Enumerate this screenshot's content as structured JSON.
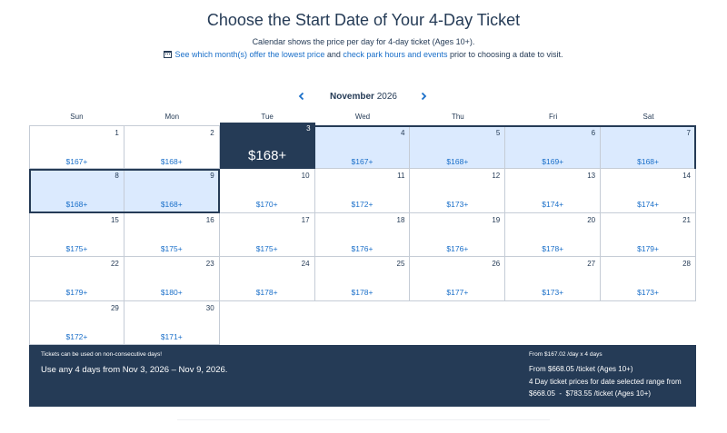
{
  "header": {
    "title": "Choose the Start Date of Your 4-Day Ticket",
    "subtitle": "Calendar shows the price per day for 4-day ticket (Ages 10+).",
    "link_lowest": "See which month(s) offer the lowest price",
    "and_text": " and ",
    "link_hours": "check park hours and events",
    "after_text": " prior to choosing a date to visit."
  },
  "calendar": {
    "month": "November",
    "year": "2026",
    "weekdays": [
      "Sun",
      "Mon",
      "Tue",
      "Wed",
      "Thu",
      "Fri",
      "Sat"
    ],
    "days": [
      {
        "day": "1",
        "price": "$167+"
      },
      {
        "day": "2",
        "price": "$168+"
      },
      {
        "day": "3",
        "price": "$168+",
        "state": "selected"
      },
      {
        "day": "4",
        "price": "$167+",
        "state": "range"
      },
      {
        "day": "5",
        "price": "$168+",
        "state": "range"
      },
      {
        "day": "6",
        "price": "$169+",
        "state": "range"
      },
      {
        "day": "7",
        "price": "$168+",
        "state": "range"
      },
      {
        "day": "8",
        "price": "$168+",
        "state": "range"
      },
      {
        "day": "9",
        "price": "$168+",
        "state": "range"
      },
      {
        "day": "10",
        "price": "$170+"
      },
      {
        "day": "11",
        "price": "$172+"
      },
      {
        "day": "12",
        "price": "$173+"
      },
      {
        "day": "13",
        "price": "$174+"
      },
      {
        "day": "14",
        "price": "$174+"
      },
      {
        "day": "15",
        "price": "$175+"
      },
      {
        "day": "16",
        "price": "$175+"
      },
      {
        "day": "17",
        "price": "$175+"
      },
      {
        "day": "18",
        "price": "$176+"
      },
      {
        "day": "19",
        "price": "$176+"
      },
      {
        "day": "20",
        "price": "$178+"
      },
      {
        "day": "21",
        "price": "$179+"
      },
      {
        "day": "22",
        "price": "$179+"
      },
      {
        "day": "23",
        "price": "$180+"
      },
      {
        "day": "24",
        "price": "$178+"
      },
      {
        "day": "25",
        "price": "$178+"
      },
      {
        "day": "26",
        "price": "$177+"
      },
      {
        "day": "27",
        "price": "$173+"
      },
      {
        "day": "28",
        "price": "$173+"
      },
      {
        "day": "29",
        "price": "$172+"
      },
      {
        "day": "30",
        "price": "$171+"
      }
    ]
  },
  "summary": {
    "note": "Tickets can be used on non-consecutive days!",
    "range_text": "Use any 4 days from Nov 3, 2026 – Nov 9, 2026.",
    "from_per_day": "From  $167.02 /day x 4 days",
    "from_ticket": "From  $668.05 /ticket (Ages 10+)",
    "range_label": "4 Day ticket prices for date selected range from",
    "range_price": "$668.05  -  $783.55 /ticket (Ages 10+)"
  },
  "colors": {
    "navy": "#253b56",
    "link": "#1a6fc9",
    "range_fill": "#dbeafe"
  }
}
